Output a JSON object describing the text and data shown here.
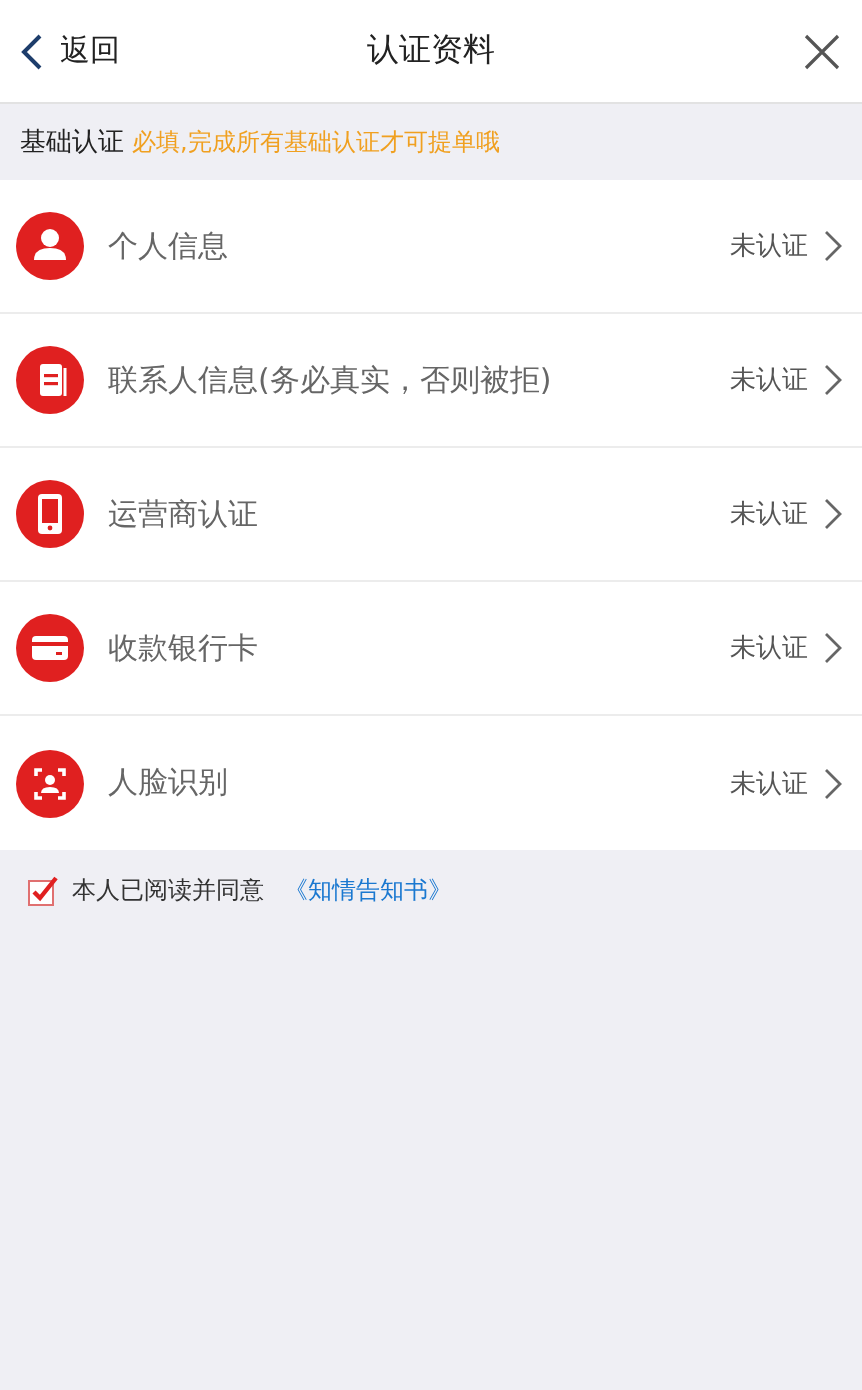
{
  "header": {
    "back": "返回",
    "title": "认证资料"
  },
  "section": {
    "title": "基础认证",
    "hint": "必填,完成所有基础认证才可提单哦"
  },
  "items": [
    {
      "kind": "person",
      "label": "个人信息",
      "status": "未认证"
    },
    {
      "kind": "contacts",
      "label": "联系人信息(务必真实，否则被拒)",
      "status": "未认证"
    },
    {
      "kind": "phone",
      "label": "运营商认证",
      "status": "未认证"
    },
    {
      "kind": "card",
      "label": "收款银行卡",
      "status": "未认证"
    },
    {
      "kind": "face",
      "label": "人脸识别",
      "status": "未认证"
    }
  ],
  "agreement": {
    "checked": true,
    "text": "本人已阅读并同意",
    "link": "《知情告知书》"
  }
}
